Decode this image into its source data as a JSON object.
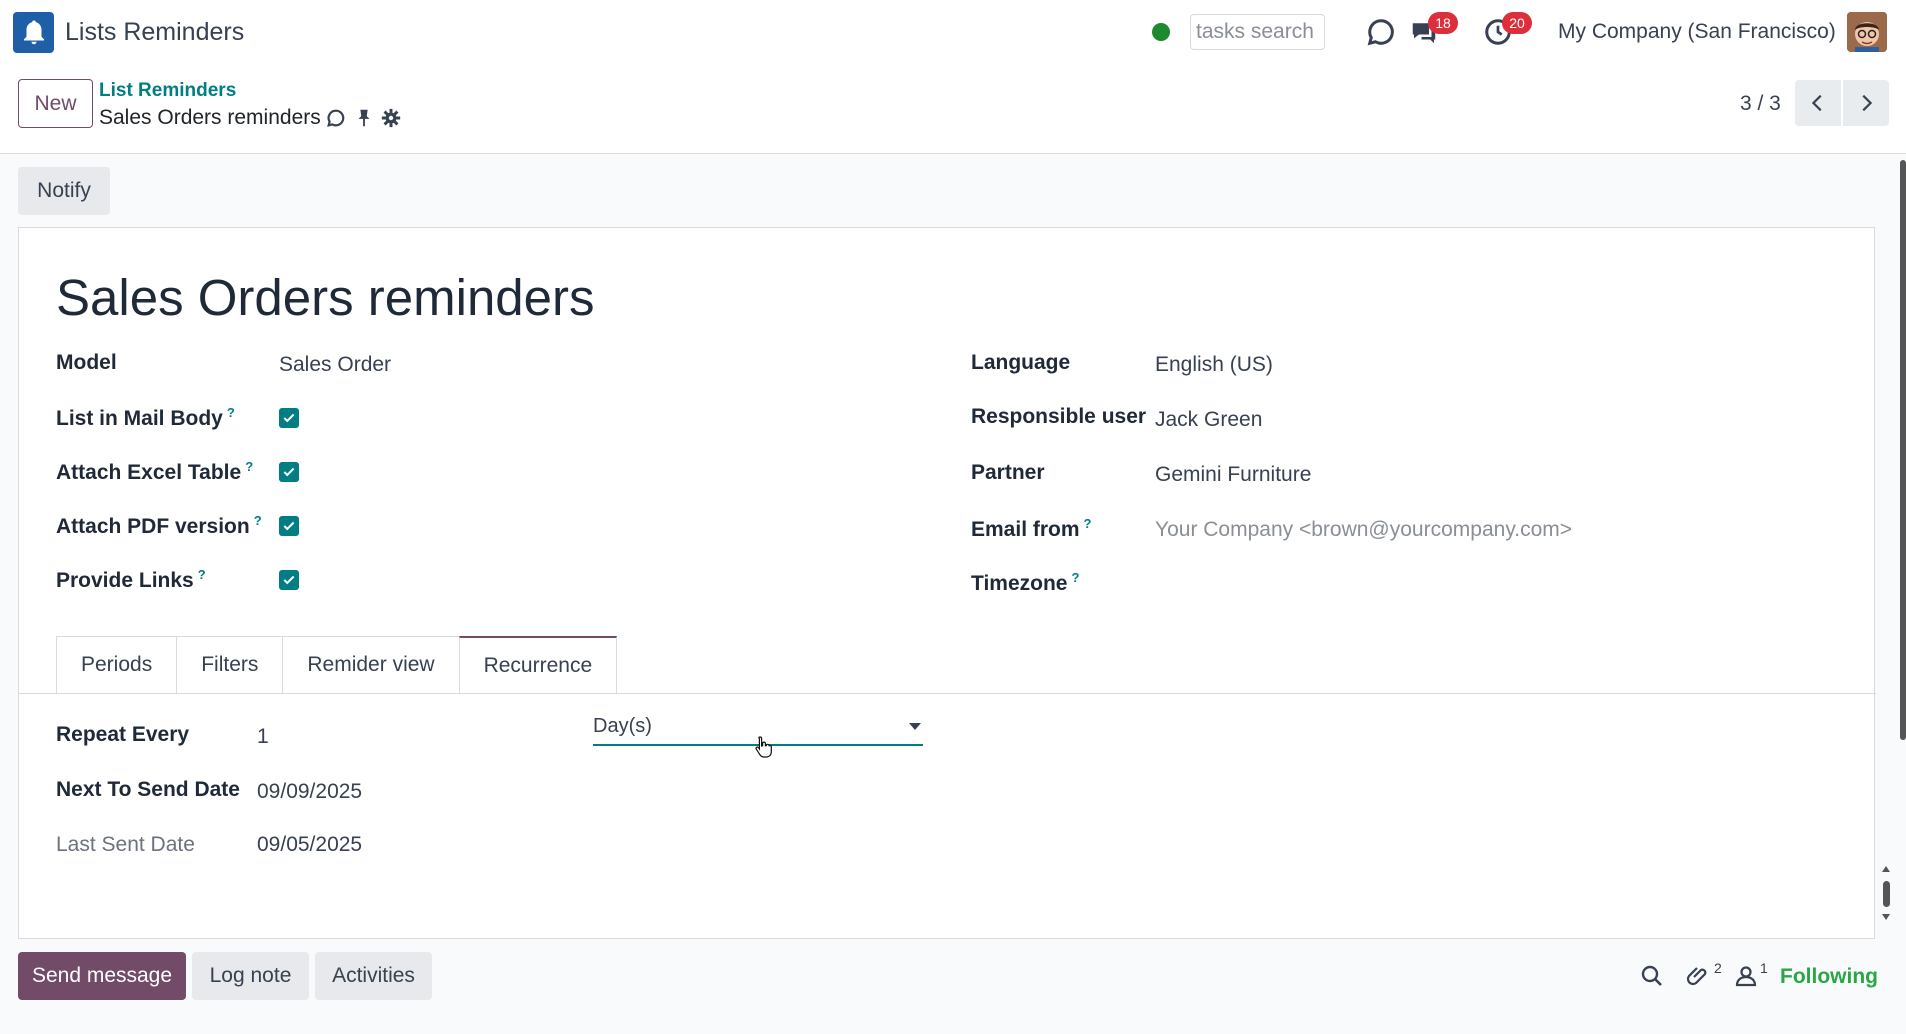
{
  "navbar": {
    "app_name": "Lists Reminders",
    "search_placeholder": "tasks search",
    "messages_badge": "18",
    "activities_badge": "20",
    "company": "My Company (San Francisco)",
    "presence_color": "#1b8a2f"
  },
  "control_panel": {
    "new_label": "New",
    "breadcrumb_parent": "List Reminders",
    "record_name": "Sales Orders reminders",
    "pager": "3 / 3"
  },
  "actions": {
    "notify_label": "Notify"
  },
  "form": {
    "title": "Sales Orders reminders",
    "left_fields": {
      "model_label": "Model",
      "model_value": "Sales Order",
      "list_in_mail_label": "List in Mail Body",
      "list_in_mail_checked": true,
      "attach_excel_label": "Attach Excel Table",
      "attach_excel_checked": true,
      "attach_pdf_label": "Attach PDF version",
      "attach_pdf_checked": true,
      "provide_links_label": "Provide Links",
      "provide_links_checked": true
    },
    "right_fields": {
      "language_label": "Language",
      "language_value": "English (US)",
      "responsible_label": "Responsible user",
      "responsible_value": "Jack Green",
      "partner_label": "Partner",
      "partner_value": "Gemini Furniture",
      "email_from_label": "Email from",
      "email_from_placeholder": "Your Company <brown@yourcompany.com>",
      "timezone_label": "Timezone",
      "timezone_value": ""
    },
    "help_mark": "?",
    "tabs": [
      {
        "label": "Periods",
        "active": false
      },
      {
        "label": "Filters",
        "active": false
      },
      {
        "label": "Remider view",
        "active": false
      },
      {
        "label": "Recurrence",
        "active": true
      }
    ],
    "recurrence": {
      "repeat_every_label": "Repeat Every",
      "repeat_every_value": "1",
      "repeat_unit": "Day(s)",
      "next_send_label": "Next To Send Date",
      "next_send_value": "09/09/2025",
      "last_sent_label": "Last Sent Date",
      "last_sent_value": "09/05/2025"
    }
  },
  "chatter": {
    "send_message_label": "Send message",
    "log_note_label": "Log note",
    "activities_label": "Activities",
    "attachments_count": "2",
    "followers_count": "1",
    "following_label": "Following"
  },
  "colors": {
    "primary": "#714b67",
    "accent": "#017e84",
    "badge": "#dc2f3b",
    "following": "#28a745"
  }
}
